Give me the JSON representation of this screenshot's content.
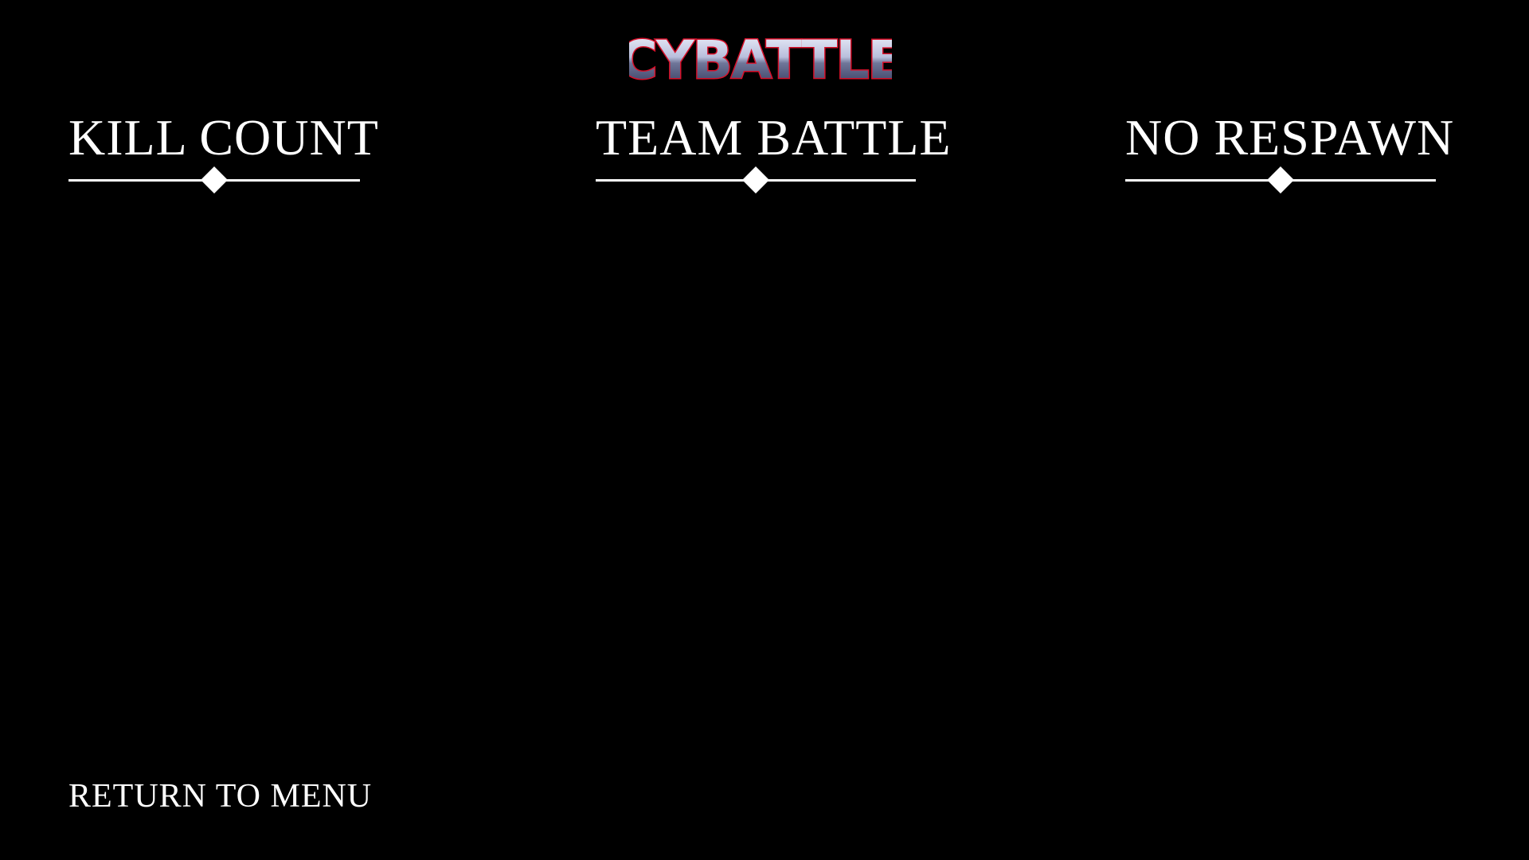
{
  "logo": {
    "text": "CYBATTLE",
    "colors": {
      "top": "#f4f6ff",
      "mid": "#8d94b6",
      "bottom": "#3a3f63",
      "outline": "#d8102a"
    }
  },
  "modes": [
    {
      "label": "KILL COUNT"
    },
    {
      "label": "TEAM BATTLE"
    },
    {
      "label": "NO RESPAWN"
    }
  ],
  "footer": {
    "return_label": "RETURN TO MENU"
  },
  "colors": {
    "background": "#000000",
    "text": "#ffffff"
  }
}
